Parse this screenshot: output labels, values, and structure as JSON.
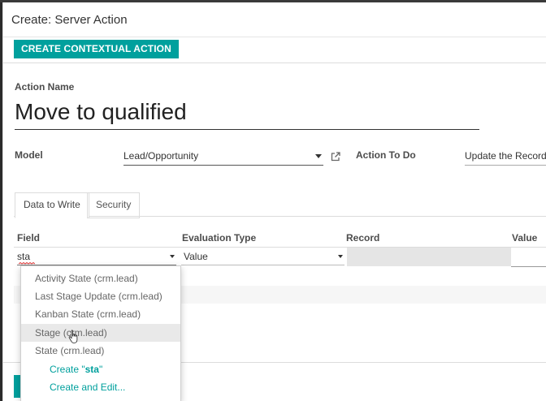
{
  "modal": {
    "title": "Create: Server Action"
  },
  "toolbar": {
    "contextual_button": "CREATE CONTEXTUAL ACTION"
  },
  "form": {
    "action_name_label": "Action Name",
    "action_name_value": "Move to qualified",
    "model_label": "Model",
    "model_value": "Lead/Opportunity",
    "action_to_do_label": "Action To Do",
    "action_to_do_value": "Update the Record"
  },
  "tabs": [
    {
      "label": "Data to Write",
      "active": true
    },
    {
      "label": "Security",
      "active": false
    }
  ],
  "table": {
    "columns": [
      "Field",
      "Evaluation Type",
      "Record",
      "Value"
    ],
    "row": {
      "field_input": "sta",
      "evaluation_type": "Value",
      "record": "",
      "value": ""
    }
  },
  "dropdown": {
    "items": [
      "Activity State (crm.lead)",
      "Last Stage Update (crm.lead)",
      "Kanban State (crm.lead)",
      "Stage (crm.lead)",
      "State (crm.lead)"
    ],
    "hovered_item": "Stage (crm.lead)",
    "create_prefix": "Create \"",
    "create_term": "sta",
    "create_suffix": "\"",
    "create_and_edit": "Create and Edit..."
  },
  "colors": {
    "accent": "#00a09d",
    "text": "#4c4c4c",
    "hover": "#e9e9e9"
  },
  "icons": [
    "external-link-icon",
    "dropdown-caret-icon",
    "hand-pointer-cursor"
  ]
}
